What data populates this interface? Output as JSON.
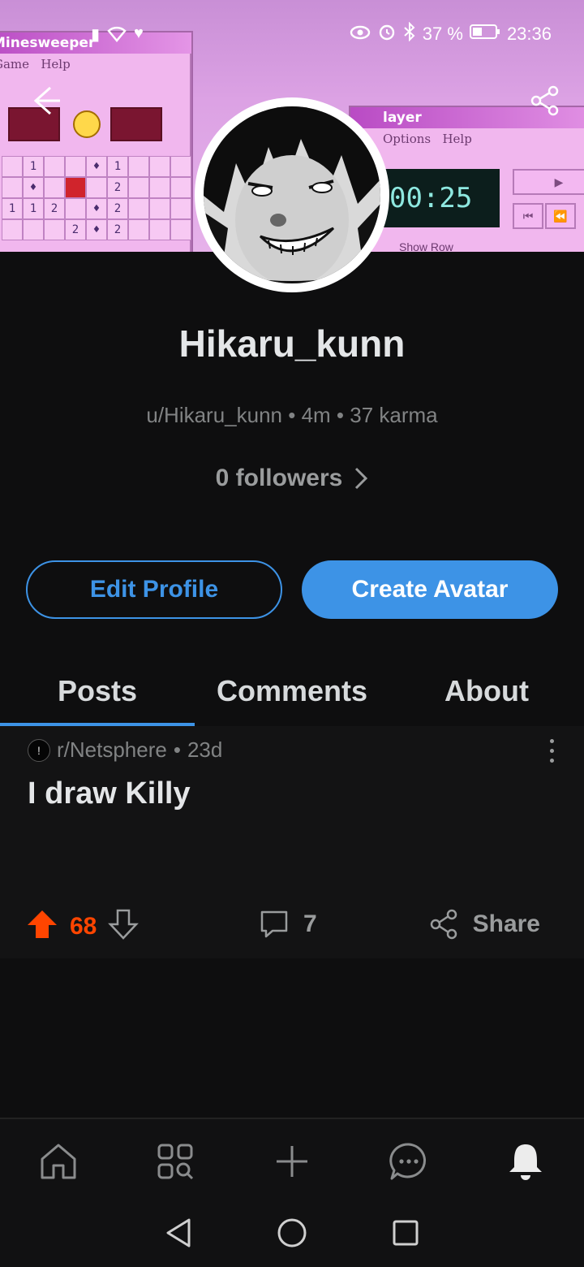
{
  "banner": {
    "minesweeper": {
      "title": "Minesweeper",
      "menu_game": "Game",
      "menu_help": "Help"
    },
    "player": {
      "title": "layer",
      "menu_options": "Options",
      "menu_help": "Help",
      "time": "00:25",
      "footer": "Show Row"
    }
  },
  "statusbar": {
    "battery": "37 %",
    "time": "23:36"
  },
  "profile": {
    "display_name": "Hikaru_kunn",
    "meta": "u/Hikaru_kunn • 4m • 37 karma",
    "followers": "0 followers",
    "edit_label": "Edit Profile",
    "avatar_label": "Create Avatar"
  },
  "tabs": [
    {
      "label": "Posts",
      "active": true
    },
    {
      "label": "Comments",
      "active": false
    },
    {
      "label": "About",
      "active": false
    }
  ],
  "post": {
    "subreddit": "r/Netsphere",
    "age": "23d",
    "title": "I draw Killy",
    "votes": "68",
    "comments": "7",
    "share_label": "Share"
  },
  "colors": {
    "accent": "#3d93e6",
    "upvote": "#ff4500",
    "background": "#0e0e0f"
  },
  "icons": {
    "bottom_nav": [
      "home-icon",
      "communities-icon",
      "create-icon",
      "chat-icon",
      "notifications-icon"
    ],
    "system_nav": [
      "back-icon",
      "home-circle-icon",
      "recents-icon"
    ]
  }
}
